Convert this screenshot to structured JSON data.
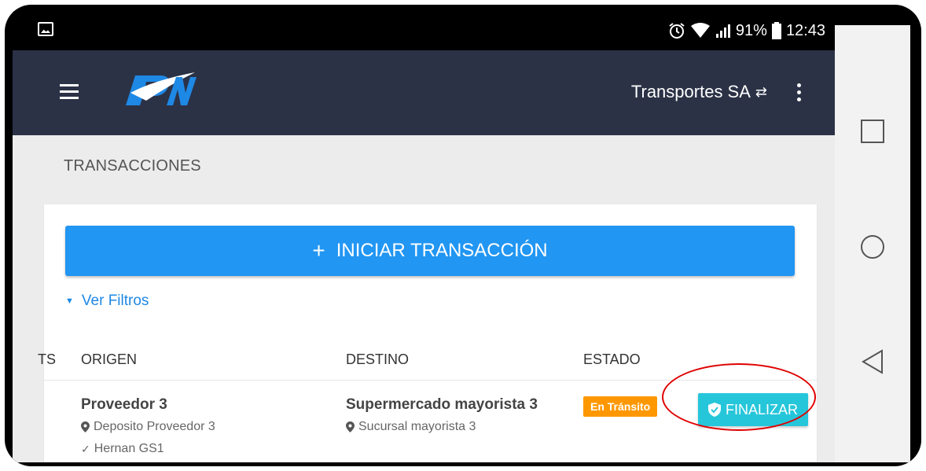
{
  "status_bar": {
    "battery": "91%",
    "time": "12:43",
    "icons": [
      "image-icon",
      "alarm-icon",
      "wifi-icon",
      "signal-icon",
      "battery-icon"
    ]
  },
  "header": {
    "account_name": "Transportes SA",
    "swap_symbol": "⇄",
    "colors": {
      "background": "#2b3246",
      "logo_blue": "#1e88e5",
      "logo_white": "#ffffff"
    }
  },
  "page": {
    "title": "TRANSACCIONES"
  },
  "actions": {
    "start_plus": "+",
    "start_label": "INICIAR TRANSACCIÓN",
    "filters_label": "Ver Filtros"
  },
  "table": {
    "columns": [
      "TS",
      "ORIGEN",
      "DESTINO",
      "ESTADO"
    ],
    "rows": [
      {
        "origin_title": "Proveedor 3",
        "origin_location": "Deposito Proveedor 3",
        "origin_user": "Hernan GS1",
        "destination_title": "Supermercado mayorista 3",
        "destination_location": "Sucursal mayorista 3",
        "status": "En Tránsito",
        "action_label": "FINALIZAR"
      }
    ]
  },
  "colors": {
    "primary_button": "#2196f3",
    "status_badge": "#ff9800",
    "finish_button": "#26c6da",
    "highlight": "#e00000"
  }
}
